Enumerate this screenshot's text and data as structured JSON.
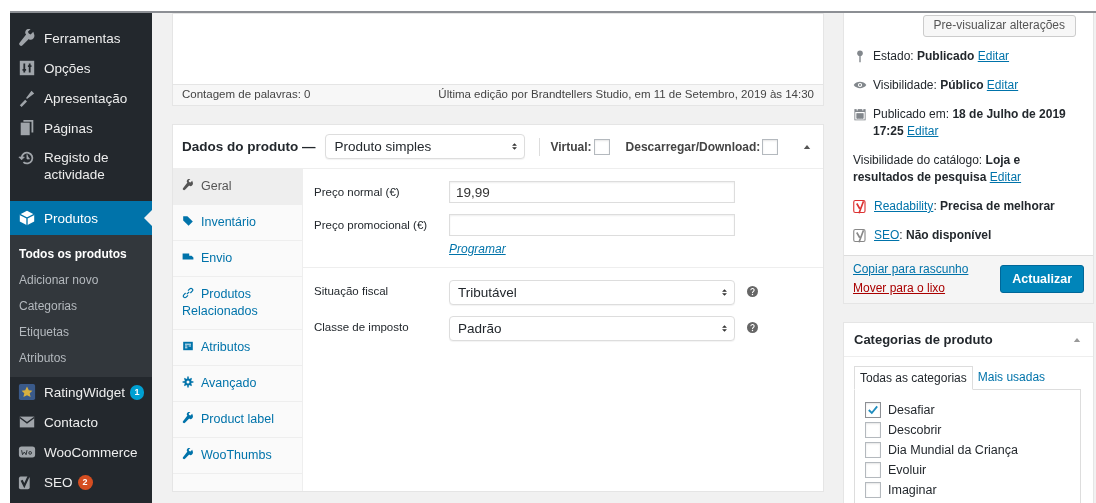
{
  "sidebar": {
    "items": [
      {
        "label": "Ferramentas",
        "selected": false
      },
      {
        "label": "Opções",
        "selected": false
      },
      {
        "label": "Apresentação",
        "selected": false
      },
      {
        "label": "Páginas",
        "selected": false
      },
      {
        "label": "Registo de actividade",
        "selected": false
      },
      {
        "label": "Produtos",
        "selected": true,
        "submenu": [
          {
            "label": "Todos os produtos",
            "selected": true
          },
          {
            "label": "Adicionar novo",
            "selected": false
          },
          {
            "label": "Categorias",
            "selected": false
          },
          {
            "label": "Etiquetas",
            "selected": false
          },
          {
            "label": "Atributos",
            "selected": false
          }
        ]
      },
      {
        "label": "RatingWidget",
        "selected": false,
        "badge": {
          "text": "1",
          "color": "#00a0d2"
        }
      },
      {
        "label": "Contacto",
        "selected": false
      },
      {
        "label": "WooCommerce",
        "selected": false
      },
      {
        "label": "SEO",
        "selected": false,
        "badge": {
          "text": "2",
          "color": "#d54e21"
        }
      }
    ]
  },
  "editor": {
    "word_count": "Contagem de palavras: 0",
    "last_edit": "Última edição por Brandtellers Studio, em 11 de Setembro, 2019 às 14:30"
  },
  "product_data": {
    "title": "Dados do produto —",
    "type_select": "Produto simples",
    "options": [
      {
        "label": "Virtual:",
        "checked": false
      },
      {
        "label": "Descarregar/Download:",
        "checked": false
      }
    ],
    "tabs": [
      {
        "label": "Geral",
        "selected": true
      },
      {
        "label": "Inventário",
        "selected": false
      },
      {
        "label": "Envio",
        "selected": false
      },
      {
        "label": "Produtos Relacionados",
        "selected": false
      },
      {
        "label": "Atributos",
        "selected": false
      },
      {
        "label": "Avançado",
        "selected": false
      },
      {
        "label": "Product label",
        "selected": false
      },
      {
        "label": "WooThumbs",
        "selected": false
      }
    ],
    "groups": [
      [
        {
          "kind": "text",
          "label": "Preço normal (€)",
          "value": "19,99"
        },
        {
          "kind": "text",
          "label": "Preço promocional (€)",
          "link": "Programar"
        }
      ],
      [
        {
          "kind": "select",
          "label": "Situação fiscal",
          "value": "Tributável"
        },
        {
          "kind": "select",
          "label": "Classe de imposto",
          "value": "Padrão"
        }
      ]
    ]
  },
  "publish": {
    "preview_button": "Pre-visualizar alterações",
    "rows": [
      {
        "text": "Estado: **Publicado**",
        "link": "Editar"
      },
      {
        "text": "Visibilidade: **Público**",
        "link": "Editar"
      },
      {
        "text": "Publicado em: **18 de Julho de 2019 17:25**",
        "link": "Editar"
      },
      {
        "text": "Visibilidade do catálogo: **Loja e resultados de pesquisa**",
        "link": "Editar"
      }
    ],
    "yoast": [
      {
        "link": "Readability",
        "text": ": **Precisa de melhorar**",
        "color": "#dc3232"
      },
      {
        "link": "SEO",
        "text": ": **Não disponível**",
        "color": "#888888"
      }
    ],
    "copy_link": "Copiar para rascunho",
    "trash_link": "Mover para o lixo",
    "update_button": "Actualizar"
  },
  "categories": {
    "title": "Categorias de produto",
    "tabs": [
      {
        "label": "Todas as categorias",
        "selected": true
      },
      {
        "label": "Mais usadas",
        "selected": false
      }
    ],
    "items": [
      {
        "label": "Desafiar",
        "checked": true
      },
      {
        "label": "Descobrir",
        "checked": false
      },
      {
        "label": "Dia Mundial da Criança",
        "checked": false
      },
      {
        "label": "Evoluir",
        "checked": false
      },
      {
        "label": "Imaginar",
        "checked": false
      }
    ]
  }
}
